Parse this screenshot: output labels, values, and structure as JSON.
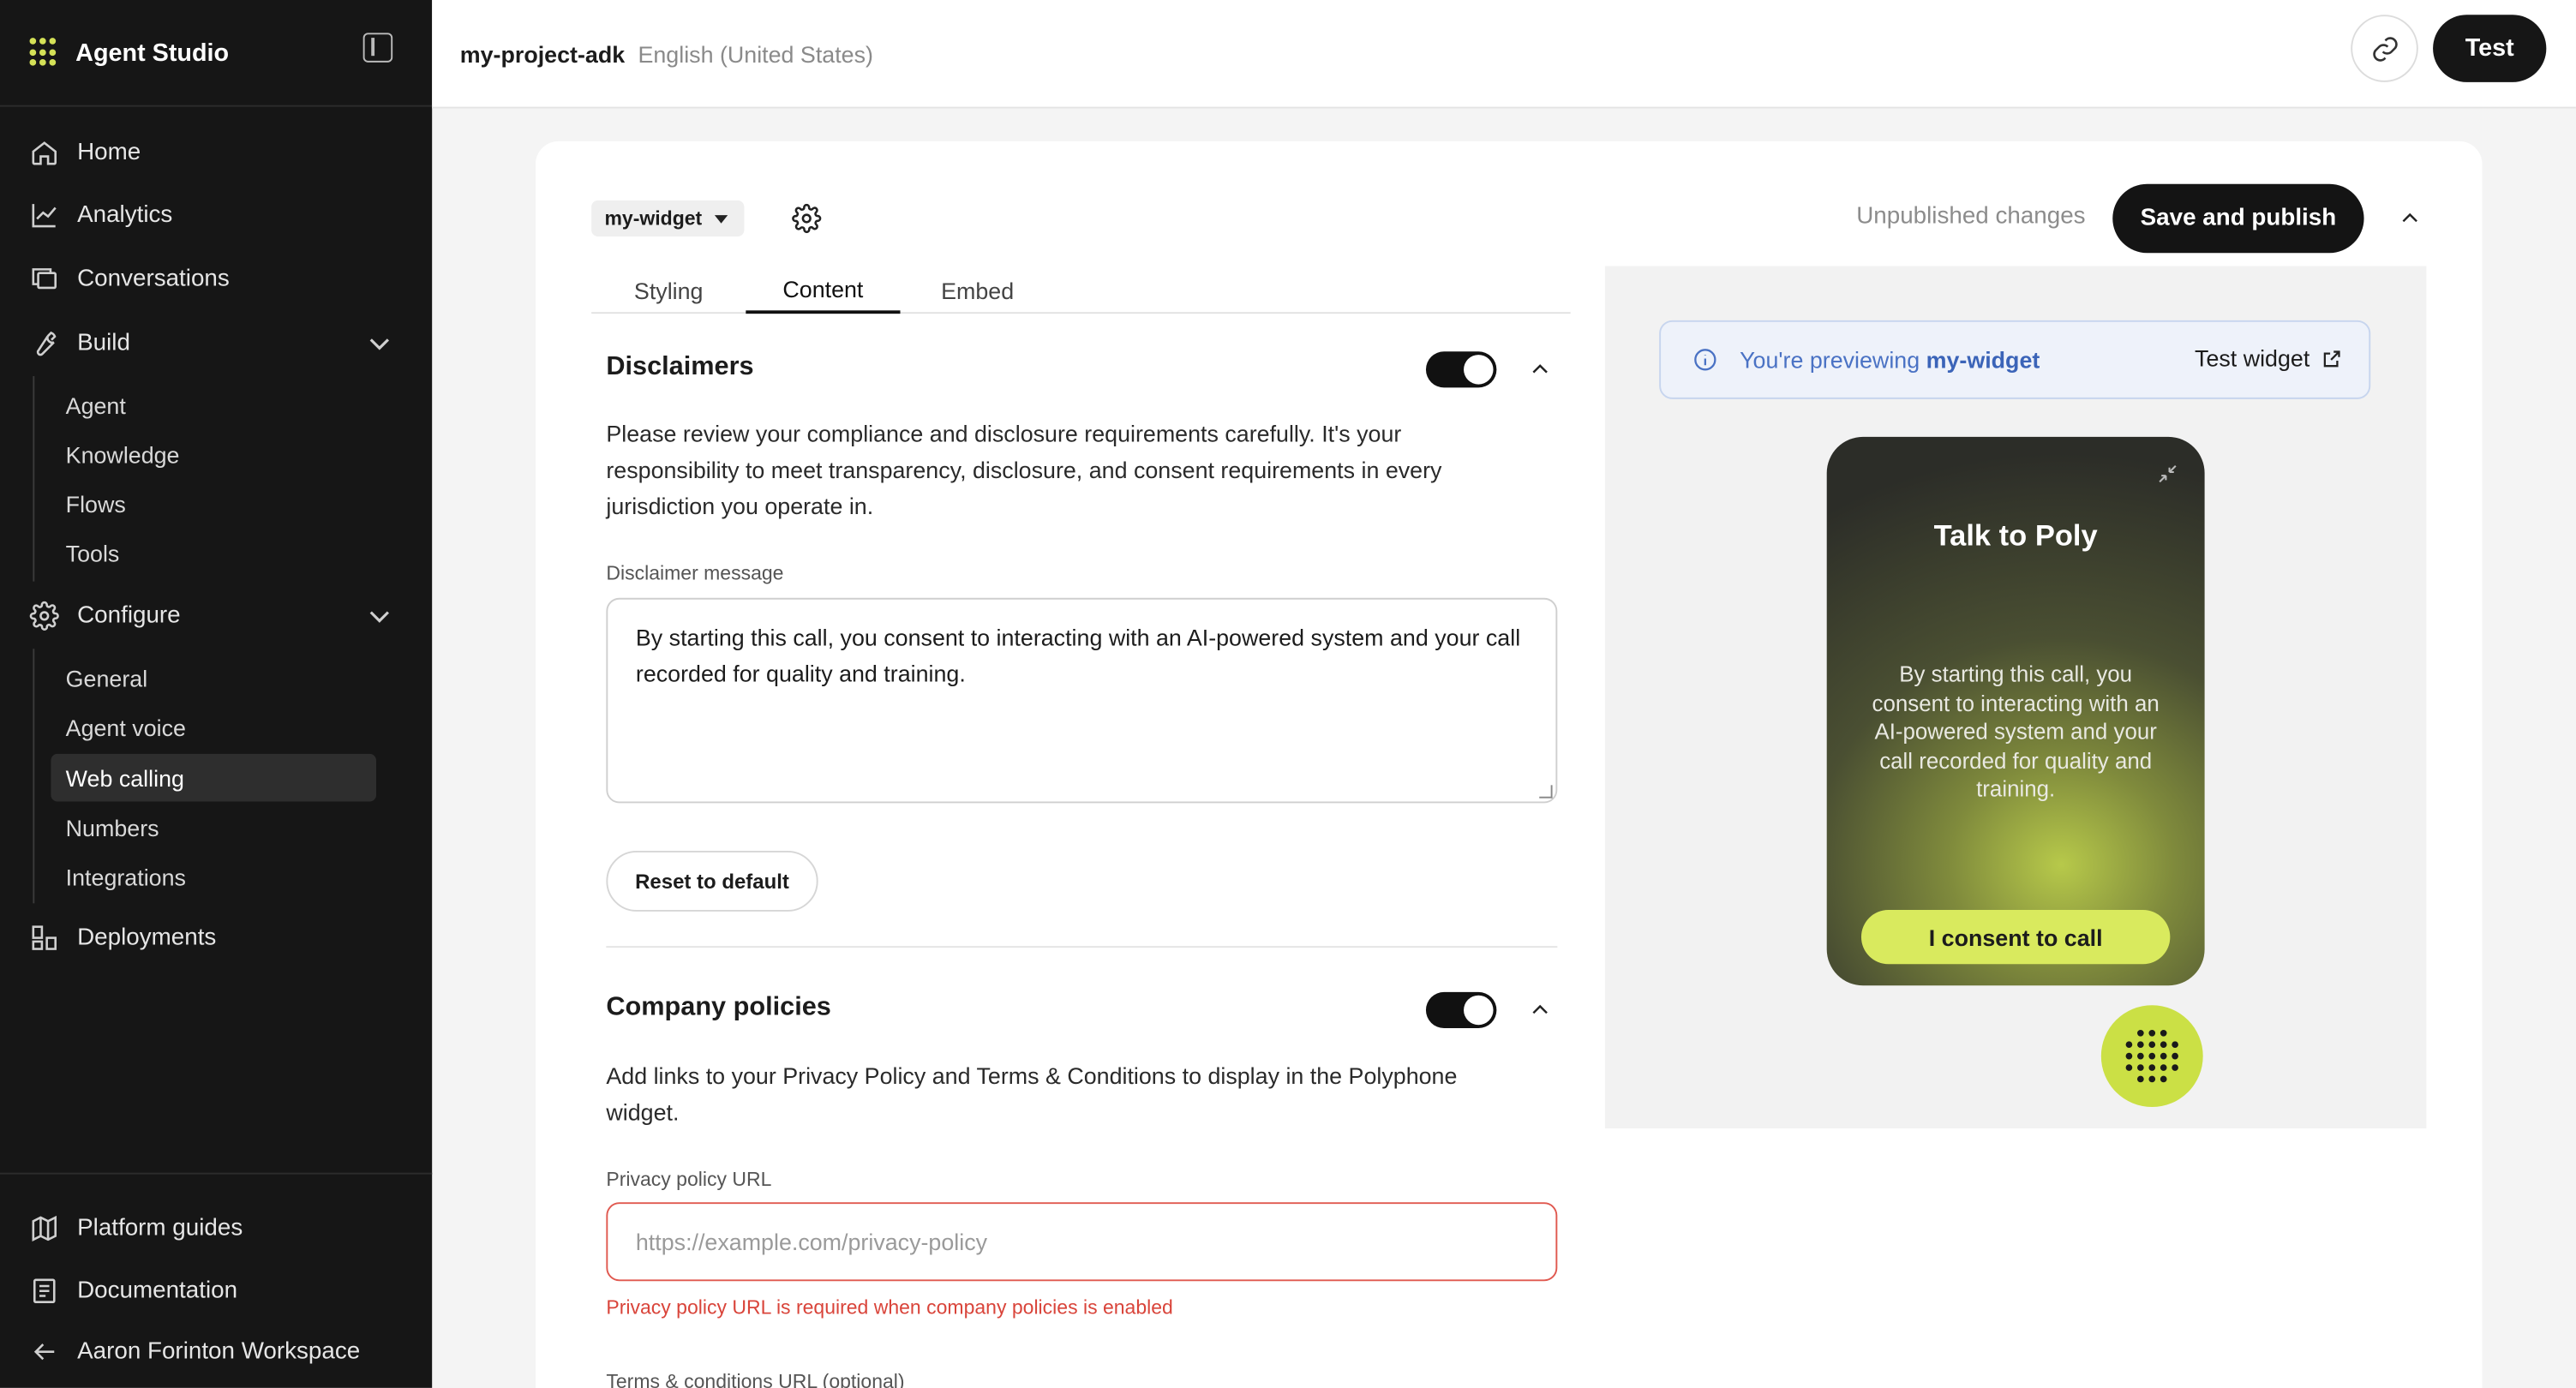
{
  "sidebar": {
    "brand": "Agent Studio",
    "nav": {
      "home": "Home",
      "analytics": "Analytics",
      "conversations": "Conversations",
      "build": "Build",
      "configure": "Configure",
      "deployments": "Deployments"
    },
    "build_items": [
      "Agent",
      "Knowledge",
      "Flows",
      "Tools"
    ],
    "configure_items": [
      "General",
      "Agent voice",
      "Web calling",
      "Numbers",
      "Integrations"
    ],
    "active_item": "Web calling",
    "bottom": {
      "platform_guides": "Platform guides",
      "documentation": "Documentation",
      "workspace": "Aaron Forinton Workspace"
    }
  },
  "topbar": {
    "project": "my-project-adk",
    "language": "English (United States)",
    "test_label": "Test"
  },
  "editor": {
    "widget_name": "my-widget",
    "status": "Unpublished changes",
    "save_label": "Save and publish",
    "tabs": [
      "Styling",
      "Content",
      "Embed"
    ],
    "active_tab": "Content",
    "disclaimers": {
      "title": "Disclaimers",
      "enabled": true,
      "description": "Please review your compliance and disclosure requirements carefully. It's your responsibility to meet transparency, disclosure, and consent requirements in every jurisdiction you operate in.",
      "message_label": "Disclaimer message",
      "message_value": "By starting this call, you consent to interacting with an AI-powered system and your call recorded for quality and training.",
      "reset_label": "Reset to default"
    },
    "policies": {
      "title": "Company policies",
      "enabled": true,
      "description": "Add links to your Privacy Policy and Terms & Conditions to display in the Polyphone widget.",
      "privacy_label": "Privacy policy URL",
      "privacy_placeholder": "https://example.com/privacy-policy",
      "privacy_error": "Privacy policy URL is required when company policies is enabled",
      "terms_label": "Terms & conditions URL (optional)"
    }
  },
  "preview": {
    "info_prefix": "You're previewing ",
    "info_widget": "my-widget",
    "test_widget_label": "Test widget",
    "phone_title": "Talk to Poly",
    "phone_message": "By starting this call, you consent to interacting with an AI-powered system and your call recorded for quality and training.",
    "consent_label": "I consent to call"
  },
  "colors": {
    "sidebar_bg": "#161616",
    "accent_lime": "#d9ea5e",
    "error_red": "#d9443a",
    "info_blue": "#4a72c4"
  }
}
